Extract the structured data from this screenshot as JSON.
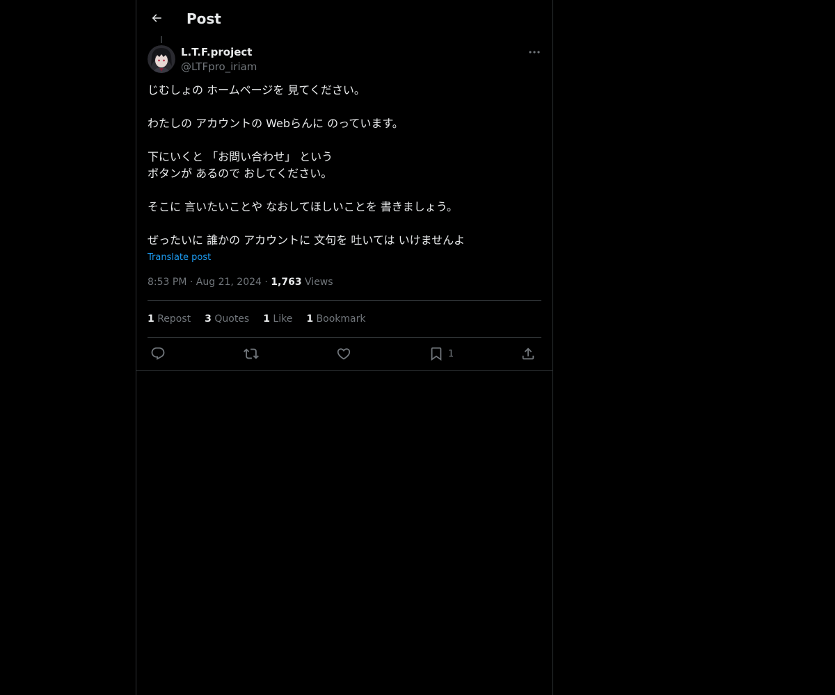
{
  "header": {
    "title": "Post",
    "back_icon": "arrow-left-icon"
  },
  "author": {
    "display_name": "L.T.F.project",
    "handle": "@LTFpro_iriam"
  },
  "post": {
    "lines": [
      "じむしょの ホームページを 見てください。",
      "",
      "わたしの アカウントの Webらんに のっています。",
      "",
      "下にいくと 「お問い合わせ」 という",
      "ボタンが あるので おしてください。",
      "",
      "そこに 言いたいことや なおしてほしいことを 書きましょう。",
      "",
      "ぜったいに 誰かの アカウントに 文句を 吐いては いけませんよ"
    ],
    "translate_label": "Translate post"
  },
  "meta": {
    "time": "8:53 PM",
    "separator": "·",
    "date": "Aug 21, 2024",
    "views_count": "1,763",
    "views_label": "Views"
  },
  "stats": [
    {
      "count": "1",
      "label": "Repost"
    },
    {
      "count": "3",
      "label": "Quotes"
    },
    {
      "count": "1",
      "label": "Like"
    },
    {
      "count": "1",
      "label": "Bookmark"
    }
  ],
  "actions": {
    "reply_icon": "reply-icon",
    "repost_icon": "repost-icon",
    "like_icon": "heart-icon",
    "bookmark_icon": "bookmark-icon",
    "bookmark_count": "1",
    "share_icon": "share-icon"
  },
  "colors": {
    "background": "#000000",
    "text": "#e7e9ea",
    "muted": "#71767b",
    "link": "#1d9bf0",
    "border": "#2f3336"
  }
}
